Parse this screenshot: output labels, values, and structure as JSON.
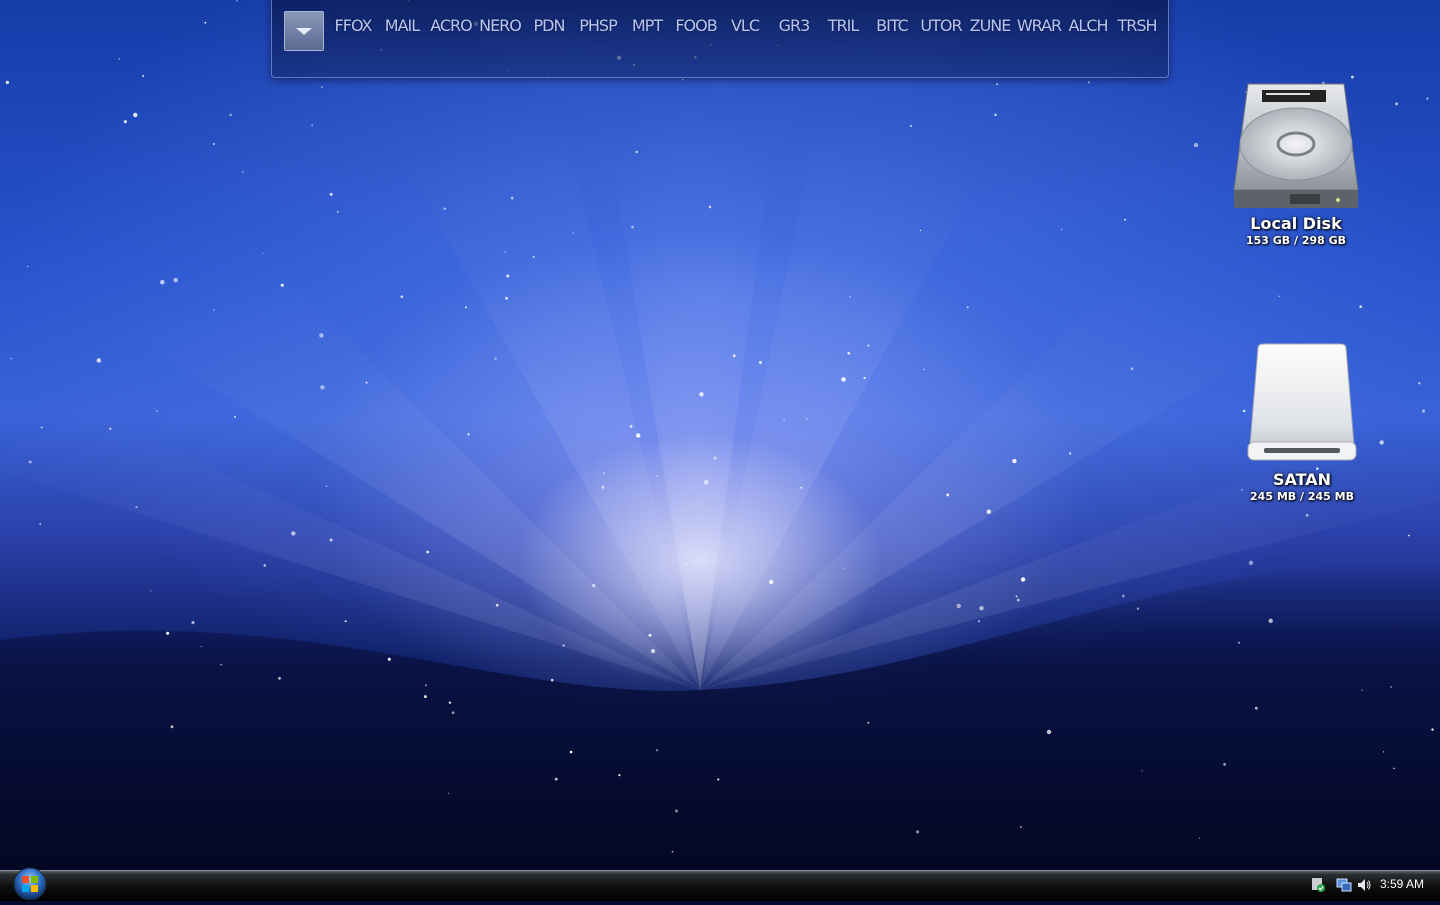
{
  "desktop": {
    "wallpaper": "aurora-space-wallpaper"
  },
  "dock": {
    "menu_icon": "chevron-down-icon",
    "items": [
      {
        "label": "FFOX"
      },
      {
        "label": "MAIL"
      },
      {
        "label": "ACRO"
      },
      {
        "label": "NERO"
      },
      {
        "label": "PDN"
      },
      {
        "label": "PHSP"
      },
      {
        "label": "MPT"
      },
      {
        "label": "FOOB"
      },
      {
        "label": "VLC"
      },
      {
        "label": "GR3"
      },
      {
        "label": "TRIL"
      },
      {
        "label": "BITC"
      },
      {
        "label": "UTOR"
      },
      {
        "label": "ZUNE"
      },
      {
        "label": "WRAR"
      },
      {
        "label": "ALCH"
      },
      {
        "label": "TRSH"
      }
    ]
  },
  "drives": [
    {
      "name": "Local Disk",
      "usage": "153 GB / 298 GB",
      "icon": "hard-disk-icon"
    },
    {
      "name": "SATAN",
      "usage": "245 MB / 245 MB",
      "icon": "removable-drive-icon"
    }
  ],
  "taskbar": {
    "start_icon": "windows-start-orb-icon",
    "tray_icons": [
      "security-shield-icon",
      "network-icon",
      "volume-icon"
    ],
    "clock": "3:59 AM"
  },
  "colors": {
    "taskbar": "#0c0d0e",
    "dock_text": "#b9c6ec",
    "wallpaper_blue": "#2753cc"
  }
}
